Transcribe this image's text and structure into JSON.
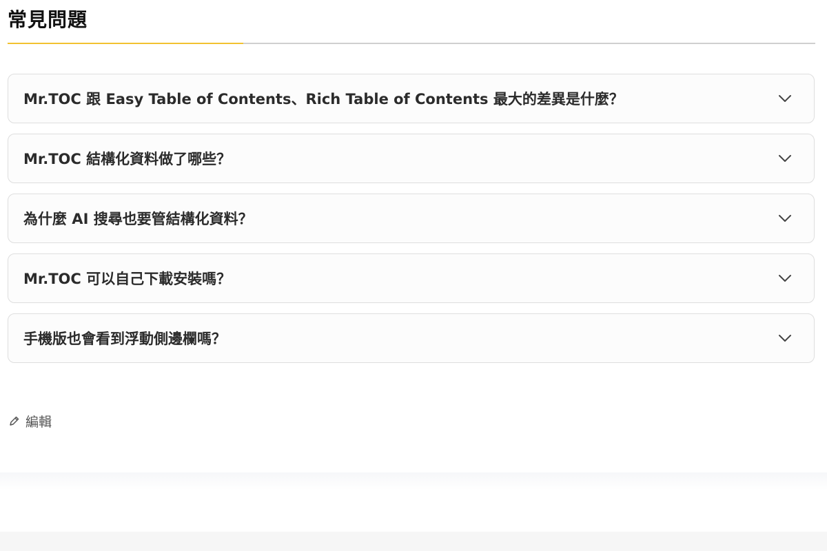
{
  "faq": {
    "title": "常見問題",
    "accent_color": "#f2c230",
    "items": [
      {
        "question": "Mr.TOC 跟 Easy Table of Contents、Rich Table of Contents 最大的差異是什麼？",
        "icon": "chevron-down-icon"
      },
      {
        "question": "Mr.TOC 結構化資料做了哪些？",
        "icon": "chevron-down-icon"
      },
      {
        "question": "為什麼 AI 搜尋也要管結構化資料？",
        "icon": "chevron-down-icon"
      },
      {
        "question": "Mr.TOC 可以自己下載安裝嗎？",
        "icon": "chevron-down-icon"
      },
      {
        "question": "手機版也會看到浮動側邊欄嗎？",
        "icon": "chevron-down-icon"
      }
    ]
  },
  "edit": {
    "label": "編輯",
    "icon": "pencil-icon"
  }
}
